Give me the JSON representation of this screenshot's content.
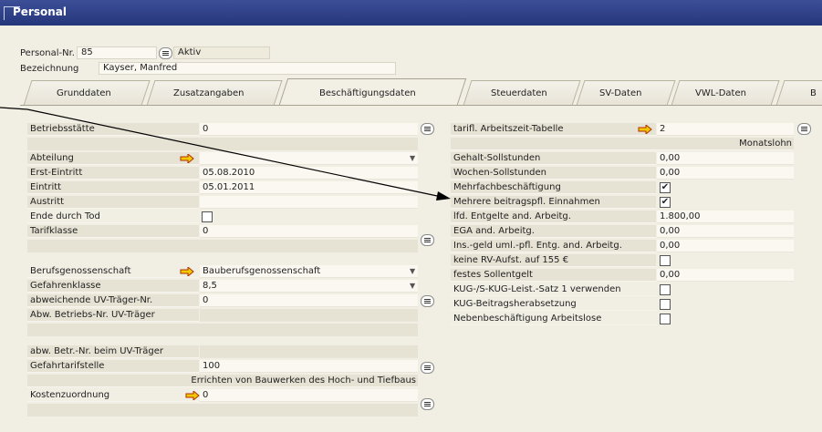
{
  "title": "Personal",
  "header": {
    "personal_nr_label": "Personal-Nr.",
    "personal_nr_value": "85",
    "status": "Aktiv",
    "bezeichnung_label": "Bezeichnung",
    "bezeichnung_value": "Kayser, Manfred"
  },
  "tabs": [
    "Grunddaten",
    "Zusatzangaben",
    "Beschäftigungsdaten",
    "Steuerdaten",
    "SV-Daten",
    "VWL-Daten",
    "B"
  ],
  "active_tab": "Beschäftigungsdaten",
  "left": {
    "betriebsstaette": {
      "label": "Betriebsstätte",
      "value": "0"
    },
    "abteilung": {
      "label": "Abteilung",
      "value": ""
    },
    "erst_eintritt": {
      "label": "Erst-Eintritt",
      "value": "05.08.2010"
    },
    "eintritt": {
      "label": "Eintritt",
      "value": "05.01.2011"
    },
    "austritt": {
      "label": "Austritt",
      "value": ""
    },
    "ende_durch_tod": {
      "label": "Ende durch Tod",
      "checked": false
    },
    "tarifklasse": {
      "label": "Tarifklasse",
      "value": "0"
    },
    "berufsgenossenschaft": {
      "label": "Berufsgenossenschaft",
      "value": "Bauberufsgenossenschaft"
    },
    "gefahrenklasse": {
      "label": "Gefahrenklasse",
      "value": "8,5"
    },
    "abw_uv_traeger_nr": {
      "label": "abweichende UV-Träger-Nr.",
      "value": "0"
    },
    "abw_betriebs_nr": {
      "label": "Abw. Betriebs-Nr. UV-Träger",
      "value": ""
    },
    "abw_betr_nr_beim": {
      "label": "abw. Betr.-Nr. beim UV-Träger",
      "value": ""
    },
    "gefahrtarifstelle": {
      "label": "Gefahrtarifstelle",
      "value": "100"
    },
    "gefahrtarif_desc": "Errichten von Bauwerken des Hoch- und Tiefbaus",
    "kostenzuordnung": {
      "label": "Kostenzuordnung",
      "value": "0"
    }
  },
  "right": {
    "tarifl_arbeitszeit": {
      "label": "tarifl. Arbeitszeit-Tabelle",
      "value": "2"
    },
    "monatslohn": "Monatslohn",
    "gehalt_sollstunden": {
      "label": "Gehalt-Sollstunden",
      "value": "0,00"
    },
    "wochen_sollstunden": {
      "label": "Wochen-Sollstunden",
      "value": "0,00"
    },
    "mehrfachbeschaeftigung": {
      "label": "Mehrfachbeschäftigung",
      "checked": true
    },
    "mehrere_einnahmen": {
      "label": "Mehrere beitragspfl. Einnahmen",
      "checked": true
    },
    "lfd_entgelte": {
      "label": "lfd. Entgelte and. Arbeitg.",
      "value": "1.800,00"
    },
    "ega": {
      "label": "EGA and. Arbeitg.",
      "value": "0,00"
    },
    "ins_geld": {
      "label": "Ins.-geld uml.-pfl. Entg. and. Arbeitg.",
      "value": "0,00"
    },
    "keine_rv": {
      "label": "keine RV-Aufst. auf 155 €",
      "checked": false
    },
    "festes_sollentgelt": {
      "label": "festes Sollentgelt",
      "value": "0,00"
    },
    "kug_satz": {
      "label": "KUG-/S-KUG-Leist.-Satz 1 verwenden",
      "checked": false
    },
    "kug_beitrag": {
      "label": "KUG-Beitragsherabsetzung",
      "checked": false
    },
    "nebenbeschaeftigung": {
      "label": "Nebenbeschäftigung Arbeitslose",
      "checked": false
    }
  },
  "check_mark": "✔",
  "colors": {
    "titlebar": "#2f418a",
    "arrow": "#f2c800",
    "panel": "#f1eee4"
  }
}
